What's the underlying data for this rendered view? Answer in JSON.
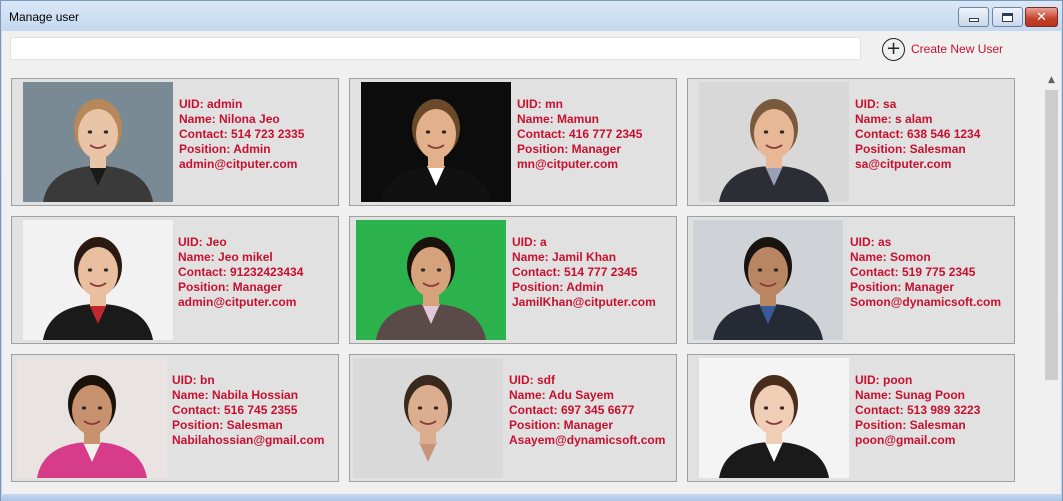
{
  "window": {
    "title": "Manage user",
    "controls": {
      "minimize": "minimize",
      "maximize": "maximize",
      "close": "close"
    }
  },
  "toolbar": {
    "search_value": "",
    "create_label": "Create New User"
  },
  "users": [
    {
      "uid": "UID: admin",
      "name": "Name: Nilona Jeo",
      "contact": "Contact: 514 723 2335",
      "position": "Position: Admin",
      "email": "admin@citputer.com",
      "photo": {
        "bg": "#7a8a94",
        "skin": "#e9c4a6",
        "hair": "#b8875a",
        "shirt": "#3a3a3a",
        "accent": "#1a1a1a"
      }
    },
    {
      "uid": "UID: mn",
      "name": "Name: Mamun",
      "contact": "Contact: 416 777 2345",
      "position": "Position: Manager",
      "email": "mn@citputer.com",
      "photo": {
        "bg": "#0c0c0c",
        "skin": "#e2b08a",
        "hair": "#6b4a2b",
        "shirt": "#111111",
        "accent": "#ffffff"
      }
    },
    {
      "uid": "UID: sa",
      "name": "Name: s alam",
      "contact": "Contact: 638 546 1234",
      "position": "Position: Salesman",
      "email": "sa@citputer.com",
      "photo": {
        "bg": "#d8d8d8",
        "skin": "#e8b896",
        "hair": "#7a5a3c",
        "shirt": "#2d2d35",
        "accent": "#9aa0b5"
      }
    },
    {
      "uid": "UID: Jeo",
      "name": "Name: Jeo mikel",
      "contact": "Contact: 91232423434",
      "position": "Position: Manager",
      "email": "admin@citputer.com",
      "photo": {
        "bg": "#f2f2f2",
        "skin": "#e9bfa0",
        "hair": "#2a1a12",
        "shirt": "#1a1a1a",
        "accent": "#c0282d"
      }
    },
    {
      "uid": "UID: a",
      "name": "Name: Jamil Khan",
      "contact": "Contact: 514 777 2345",
      "position": "Position: Admin",
      "email": "JamilKhan@citputer.com",
      "photo": {
        "bg": "#2bb24c",
        "skin": "#d6a27b",
        "hair": "#1a120c",
        "shirt": "#5a4a48",
        "accent": "#e0c8d8"
      }
    },
    {
      "uid": "UID: as",
      "name": "Name: Somon",
      "contact": "Contact: 519 775 2345",
      "position": "Position: Manager",
      "email": "Somon@dynamicsoft.com",
      "photo": {
        "bg": "#cfd3d8",
        "skin": "#b98563",
        "hair": "#1a1410",
        "shirt": "#252a35",
        "accent": "#3a5a9a"
      }
    },
    {
      "uid": "UID: bn",
      "name": "Name: Nabila Hossian",
      "contact": "Contact: 516 745 2355",
      "position": "Position: Salesman",
      "email": "Nabilahossian@gmail.com",
      "photo": {
        "bg": "#e9e4e1",
        "skin": "#c9926e",
        "hair": "#1c120c",
        "shirt": "#d63c8a",
        "accent": "#f4f0ea"
      }
    },
    {
      "uid": "UID: sdf",
      "name": "Name: Adu Sayem",
      "contact": "Contact: 697 345 6677",
      "position": "Position: Manager",
      "email": "Asayem@dynamicsoft.com",
      "photo": {
        "bg": "#d9d9d9",
        "skin": "#dcae90",
        "hair": "#3a2a1e",
        "shirt": "#d9d9d9",
        "accent": "#c7967a"
      }
    },
    {
      "uid": "UID: poon",
      "name": "Name: Sunag Poon",
      "contact": "Contact: 513 989 3223",
      "position": "Position: Salesman",
      "email": "poon@gmail.com",
      "photo": {
        "bg": "#f4f4f4",
        "skin": "#f0cdb5",
        "hair": "#4a2c1c",
        "shirt": "#1a1a1a",
        "accent": "#ffffff"
      }
    }
  ],
  "scrollbar": {
    "up_arrow": "scroll-up-arrow"
  }
}
